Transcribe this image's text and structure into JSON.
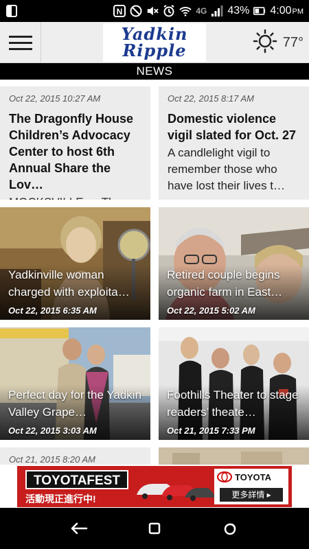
{
  "status_bar": {
    "battery": "43%",
    "time": "4:00",
    "ampm": "PM",
    "network": "4G"
  },
  "app": {
    "logo_line1": "Yadkin",
    "logo_line2": "Ripple",
    "weather_temp": "77°",
    "weather_icon": "sun-icon"
  },
  "section": {
    "label": "NEWS"
  },
  "articles": [
    {
      "date": "Oct 22, 2015 10:27 AM",
      "title": "The Dragonfly House Children’s Advocacy Center to host 6th Annual Share the Lov…",
      "excerpt": "MOCKSVILLE — The…"
    },
    {
      "date": "Oct 22, 2015 8:17 AM",
      "title": "Domestic violence vigil slated for Oct. 27",
      "excerpt": "A candlelight vigil to remember those who have lost their lives t…"
    },
    {
      "title": "Yadkinville woman charged with exploita…",
      "date": "Oct 22, 2015 6:35 AM"
    },
    {
      "title": "Retired couple begins organic farm in East…",
      "date": "Oct 22, 2015 5:02 AM"
    },
    {
      "title": "Perfect day for the Yadkin Valley Grape…",
      "date": "Oct 22, 2015 3:03 AM"
    },
    {
      "title": "Foothills Theater to stage readers’ theate…",
      "date": "Oct 21, 2015 7:33 PM"
    },
    {
      "date": "Oct 21, 2015 8:20 AM"
    }
  ],
  "ad": {
    "brand": "TOYOTAFEST",
    "sub": "活動現正進行中!",
    "logo": "TOYOTA",
    "more": "更多詳情 ▸"
  },
  "colors": {
    "ad_red": "#c71d1d",
    "logo_blue": "#1c3a8f"
  }
}
